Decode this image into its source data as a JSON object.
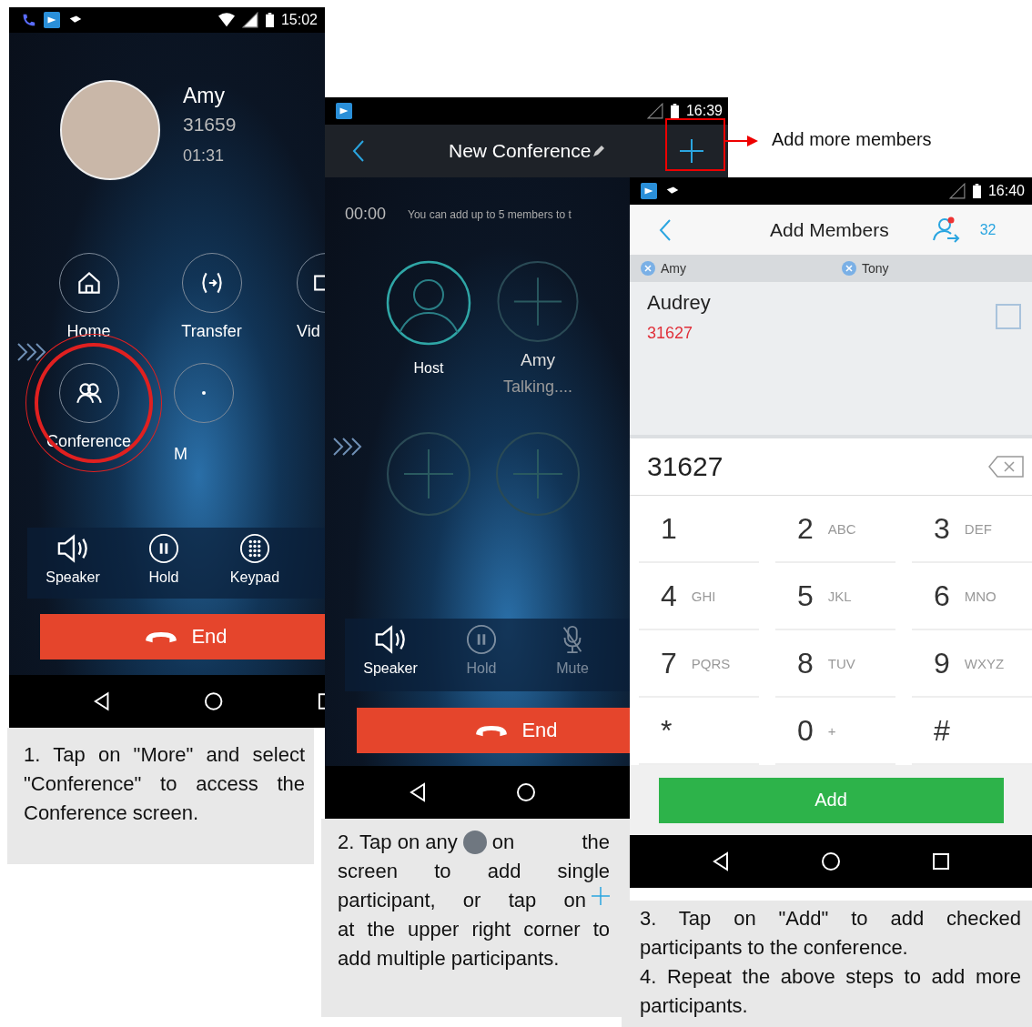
{
  "call_screen": {
    "status_bar": {
      "time": "15:02"
    },
    "contact": {
      "name": "Amy",
      "number": "31659",
      "duration": "01:31"
    },
    "features": [
      {
        "kind": "home",
        "label": "Home",
        "circled": false
      },
      {
        "kind": "transfer",
        "label": "Transfer",
        "circled": false
      },
      {
        "kind": "video",
        "label": "Vid",
        "circled": false
      },
      {
        "kind": "conference",
        "label": "Conference",
        "circled": true
      },
      {
        "kind": "more",
        "label": "M",
        "circled": false
      }
    ],
    "controls": [
      {
        "kind": "speaker",
        "label": "Speaker",
        "disabled": false
      },
      {
        "kind": "hold",
        "label": "Hold",
        "disabled": false
      },
      {
        "kind": "keypad",
        "label": "Keypad",
        "disabled": false
      }
    ],
    "end_button": "End"
  },
  "caption_1": "1. Tap on \"More\" and select \"Conference\" to access the Conference screen.",
  "conference_screen": {
    "status_bar": {
      "time": "16:39"
    },
    "title": "New Conference",
    "timer": "00:00",
    "notice": "You can add up to 5 members to t",
    "participants": [
      {
        "kind": "host",
        "label": "Host"
      },
      {
        "kind": "member",
        "label": "Amy",
        "status": "Talking...."
      },
      {
        "kind": "empty"
      },
      {
        "kind": "empty"
      }
    ],
    "controls": [
      {
        "kind": "speaker",
        "label": "Speaker",
        "disabled": false
      },
      {
        "kind": "hold",
        "label": "Hold",
        "disabled": true
      },
      {
        "kind": "mute",
        "label": "Mute",
        "disabled": true
      }
    ],
    "end_button": "End"
  },
  "annotation": "Add more members",
  "caption_2": [
    [
      {
        "kind": "text",
        "text": "2. Tap on any"
      },
      {
        "kind": "dot"
      },
      {
        "kind": "text",
        "text": "on the"
      }
    ],
    [
      {
        "kind": "text",
        "text": "screen to add single"
      }
    ],
    [
      {
        "kind": "text",
        "text": "participant, or tap on"
      },
      {
        "kind": "plus"
      }
    ],
    [
      {
        "kind": "text",
        "text": "at the upper right corner to"
      }
    ],
    [
      {
        "kind": "text",
        "text": "add multiple participants."
      }
    ]
  ],
  "add_members_screen": {
    "status_bar": {
      "time": "16:40"
    },
    "title": "Add Members",
    "count": "32",
    "chips": [
      "Amy",
      "Tony"
    ],
    "contacts": [
      {
        "name": "Audrey",
        "number": "31627",
        "checked": false
      }
    ],
    "input": "31627",
    "keys": [
      {
        "digit": "1"
      },
      {
        "digit": "2",
        "letters": "ABC"
      },
      {
        "digit": "3",
        "letters": "DEF"
      },
      {
        "digit": "4",
        "letters": "GHI"
      },
      {
        "digit": "5",
        "letters": "JKL"
      },
      {
        "digit": "6",
        "letters": "MNO"
      },
      {
        "digit": "7",
        "letters": "PQRS"
      },
      {
        "digit": "8",
        "letters": "TUV"
      },
      {
        "digit": "9",
        "letters": "WXYZ"
      },
      {
        "digit": "*"
      },
      {
        "digit": "0",
        "letters": "+"
      },
      {
        "digit": "#"
      }
    ],
    "add_button": "Add"
  },
  "caption_3": [
    "3. Tap on \"Add\" to add checked participants to the conference.",
    "4. Repeat the above steps to add more participants."
  ]
}
